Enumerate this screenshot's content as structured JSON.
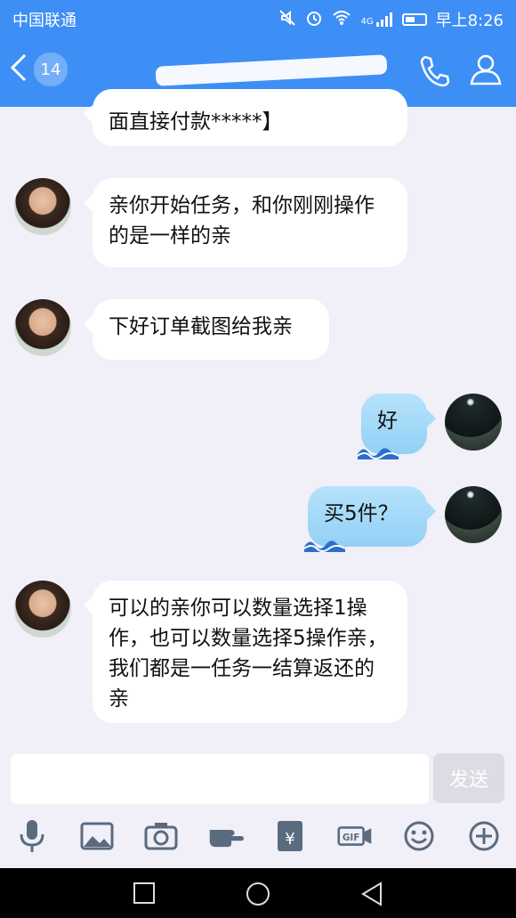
{
  "status": {
    "carrier": "中国联通",
    "network": "4G",
    "time": "早上8:26"
  },
  "header": {
    "unread_count": "14"
  },
  "messages": [
    {
      "side": "left",
      "text": "面直接付款*****】"
    },
    {
      "side": "left",
      "text": "亲你开始任务，和你刚刚操作的是一样的亲"
    },
    {
      "side": "left",
      "text": "下好订单截图给我亲"
    },
    {
      "side": "right",
      "text": "好"
    },
    {
      "side": "right",
      "text": "买5件？"
    },
    {
      "side": "left",
      "text": "可以的亲你可以数量选择1操作，也可以数量选择5操作亲，我们都是一任务一结算返还的亲"
    }
  ],
  "input": {
    "send_label": "发送"
  },
  "toolbar": [
    "microphone-icon",
    "image-icon",
    "camera-icon",
    "hand-icon",
    "red-packet-icon",
    "gif-icon",
    "emoji-icon",
    "plus-icon"
  ],
  "colors": {
    "header": "#3e8ff5",
    "bubble_right": "#a8dbf8"
  }
}
